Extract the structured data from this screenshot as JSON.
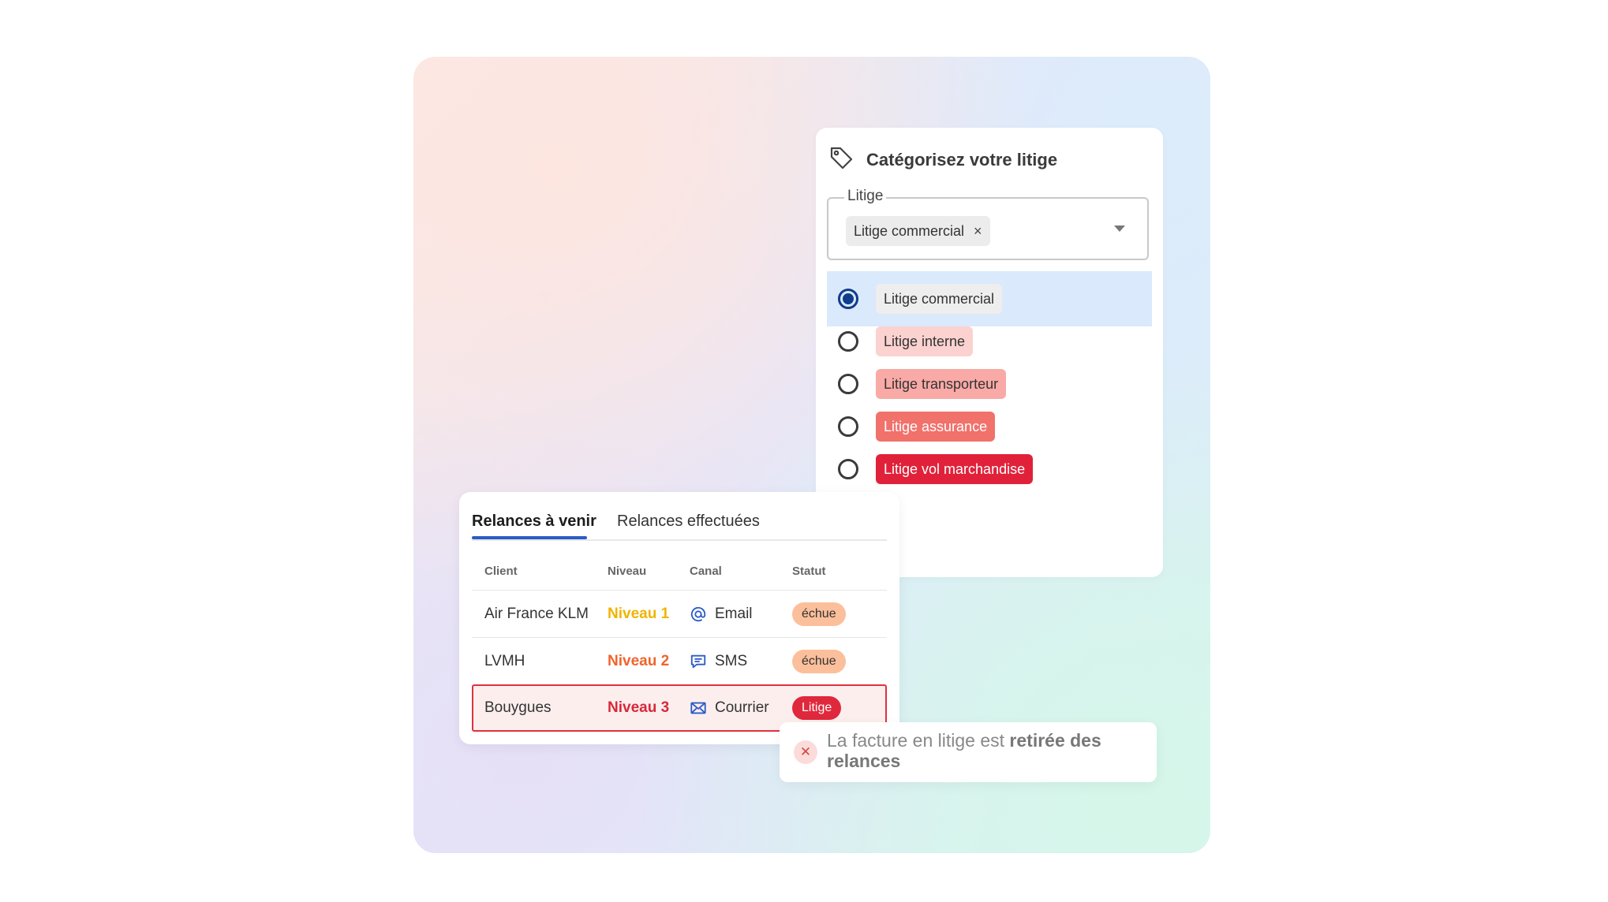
{
  "categorize": {
    "title": "Catégorisez votre litige",
    "icon": "tag-icon",
    "field_label": "Litige",
    "chip_value": "Litige commercial",
    "chip_remove": "×",
    "options": [
      {
        "label": "Litige commercial",
        "selected": true,
        "bg": "#eeeeee",
        "fg": "#333333"
      },
      {
        "label": "Litige interne",
        "selected": false,
        "bg": "#fbd2d0",
        "fg": "#333333"
      },
      {
        "label": "Litige transporteur",
        "selected": false,
        "bg": "#f9aaa6",
        "fg": "#333333"
      },
      {
        "label": "Litige assurance",
        "selected": false,
        "bg": "#f1716b",
        "fg": "#ffffff"
      },
      {
        "label": "Litige vol marchandise",
        "selected": false,
        "bg": "#e1213a",
        "fg": "#ffffff"
      }
    ]
  },
  "relances": {
    "tabs": [
      "Relances à venir",
      "Relances effectuées"
    ],
    "active_tab": 0,
    "columns": [
      "Client",
      "Niveau",
      "Canal",
      "Statut"
    ],
    "rows": [
      {
        "client": "Air France KLM",
        "niveau": "Niveau 1",
        "niveau_color": "#f0b400",
        "canal": "Email",
        "canal_icon": "at-sign-icon",
        "statut": "échue",
        "statut_bg": "#fbbf9b",
        "statut_fg": "#333333"
      },
      {
        "client": "LVMH",
        "niveau": "Niveau 2",
        "niveau_color": "#f0642d",
        "canal": "SMS",
        "canal_icon": "chat-bubble-icon",
        "statut": "échue",
        "statut_bg": "#fbbf9b",
        "statut_fg": "#333333"
      },
      {
        "client": "Bouygues",
        "niveau": "Niveau 3",
        "niveau_color": "#d8283a",
        "canal": "Courrier",
        "canal_icon": "envelope-icon",
        "statut": "Litige",
        "statut_bg": "#e0283c",
        "statut_fg": "#ffffff"
      }
    ]
  },
  "toast": {
    "prefix": "La facture en litige est ",
    "bold": "retirée des relances",
    "icon": "close-icon"
  },
  "colors": {
    "accent": "#2b5cc5",
    "radio_selected": "#0f3d8a",
    "highlight_border": "#e0303f"
  }
}
